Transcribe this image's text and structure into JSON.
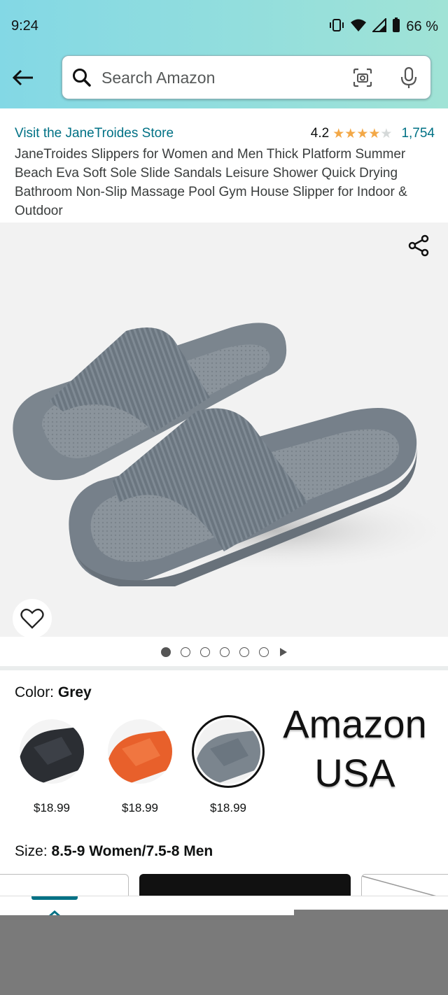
{
  "status_bar": {
    "time": "9:24",
    "battery": "66 %",
    "icons": [
      "vibrate-icon",
      "wifi-icon",
      "signal-icon",
      "battery-icon"
    ]
  },
  "header": {
    "back_icon": "arrow-left-icon",
    "search": {
      "placeholder": "Search Amazon",
      "value": ""
    },
    "lens_icon": "camera-lens-icon",
    "mic_icon": "microphone-icon"
  },
  "product": {
    "store_link": "Visit the JaneTroides Store",
    "rating": "4.2",
    "rating_value": 4.2,
    "rating_max": 5,
    "review_count": "1,754",
    "title": "JaneTroides Slippers for Women and Men Thick Platform Summer Beach Eva Soft Sole Slide Sandals Leisure Shower Quick Drying Bathroom Non-Slip Massage Pool Gym House Slipper for Indoor & Outdoor"
  },
  "gallery": {
    "share_icon": "share-icon",
    "wishlist_icon": "heart-icon",
    "image_count": 6,
    "active_index": 0,
    "has_video": true
  },
  "color": {
    "label": "Color: ",
    "selected": "Grey",
    "options": [
      {
        "name": "black",
        "price": "$18.99"
      },
      {
        "name": "orange",
        "price": "$18.99"
      },
      {
        "name": "grey",
        "price": "$18.99",
        "selected": true
      }
    ]
  },
  "watermark": {
    "line1": "Amazon",
    "line2": "USA"
  },
  "size": {
    "label": "Size: ",
    "selected": "8.5-9 Women/7.5-8 Men"
  },
  "colors": {
    "link": "#007185",
    "star": "#f3a847",
    "header_start": "#83d8e5",
    "header_end": "#a0e3d6"
  },
  "bottom_nav": {
    "items": [
      "home-icon",
      "account-icon",
      "cart-icon",
      "menu-icon"
    ],
    "active": 0
  }
}
